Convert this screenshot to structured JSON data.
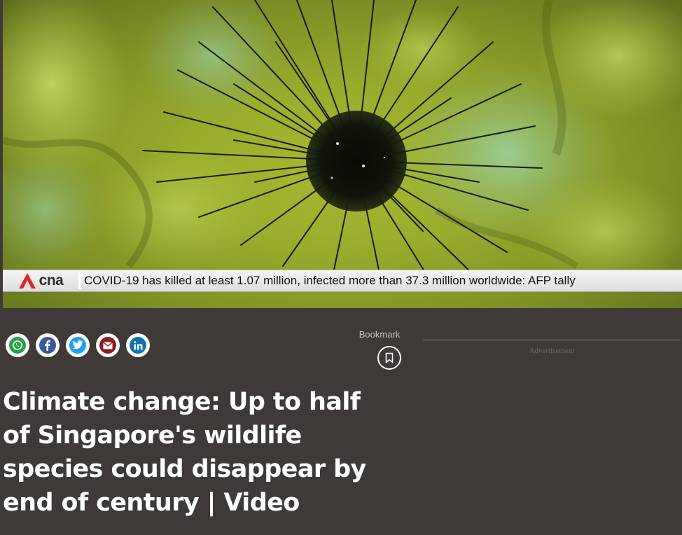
{
  "video": {
    "ticker": {
      "brand": "cna",
      "text": "COVID-19 has killed at least 1.07 million, infected more than 37.3 million worldwide: AFP tally"
    }
  },
  "share": {
    "buttons": [
      {
        "name": "whatsapp",
        "icon": "whatsapp-icon",
        "color": "#25a244"
      },
      {
        "name": "facebook",
        "icon": "facebook-icon",
        "color": "#3b5998"
      },
      {
        "name": "twitter",
        "icon": "twitter-icon",
        "color": "#1da1f2"
      },
      {
        "name": "email",
        "icon": "mail-icon",
        "color": "#8b1c22"
      },
      {
        "name": "linkedin",
        "icon": "linkedin-icon",
        "color": "#0e76a8"
      }
    ]
  },
  "bookmark": {
    "label": "Bookmark",
    "icon": "bookmark-icon"
  },
  "advertisement": {
    "label": "Advertisement"
  },
  "article": {
    "title": "Climate change: Up to half of Singapore's wildlife species could disappear by end of century | Video"
  },
  "colors": {
    "page_background": "#3f3a37",
    "cna_red": "#d7282f"
  }
}
